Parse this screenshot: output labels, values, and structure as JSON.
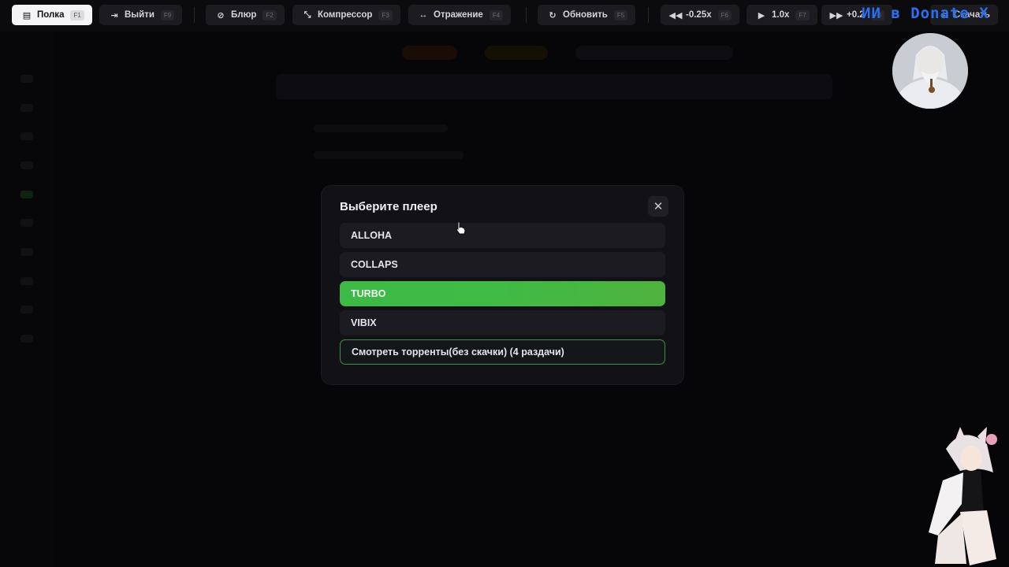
{
  "toolbar": {
    "buttons": [
      {
        "label": "Полка",
        "key": "F1",
        "icon": "shelf-icon",
        "active": true
      },
      {
        "label": "Выйти",
        "key": "F9",
        "icon": "exit-icon"
      },
      {
        "label": "Блюр",
        "key": "F2",
        "icon": "eye-off-icon"
      },
      {
        "label": "Компрессор",
        "key": "F3",
        "icon": "compress-icon"
      },
      {
        "label": "Отражение",
        "key": "F4",
        "icon": "mirror-icon"
      },
      {
        "label": "Обновить",
        "key": "F5",
        "icon": "refresh-icon"
      },
      {
        "label": "-0.25x",
        "key": "F6",
        "icon": "rewind-icon"
      },
      {
        "label": "1.0x",
        "key": "F7",
        "icon": "play-icon"
      },
      {
        "label": "+0.2",
        "key": "F8",
        "icon": "fast-forward-icon"
      },
      {
        "label": "Скачать",
        "icon": "download-icon"
      }
    ]
  },
  "overlay": {
    "donate_text": "ИИ в Donate X"
  },
  "modal": {
    "title": "Выберите плеер",
    "close_icon": "close-icon",
    "options": [
      {
        "label": "ALLOHA"
      },
      {
        "label": "COLLAPS"
      },
      {
        "label": "TURBO",
        "selected": true
      },
      {
        "label": "VIBIX"
      },
      {
        "label": "Смотреть торренты(без скачки) (4 раздачи)",
        "style": "outlined"
      }
    ]
  },
  "colors": {
    "accent_green": "#3fba46",
    "background": "#060608",
    "modal_bg": "#121216",
    "donate_blue": "#2f6fe8"
  }
}
